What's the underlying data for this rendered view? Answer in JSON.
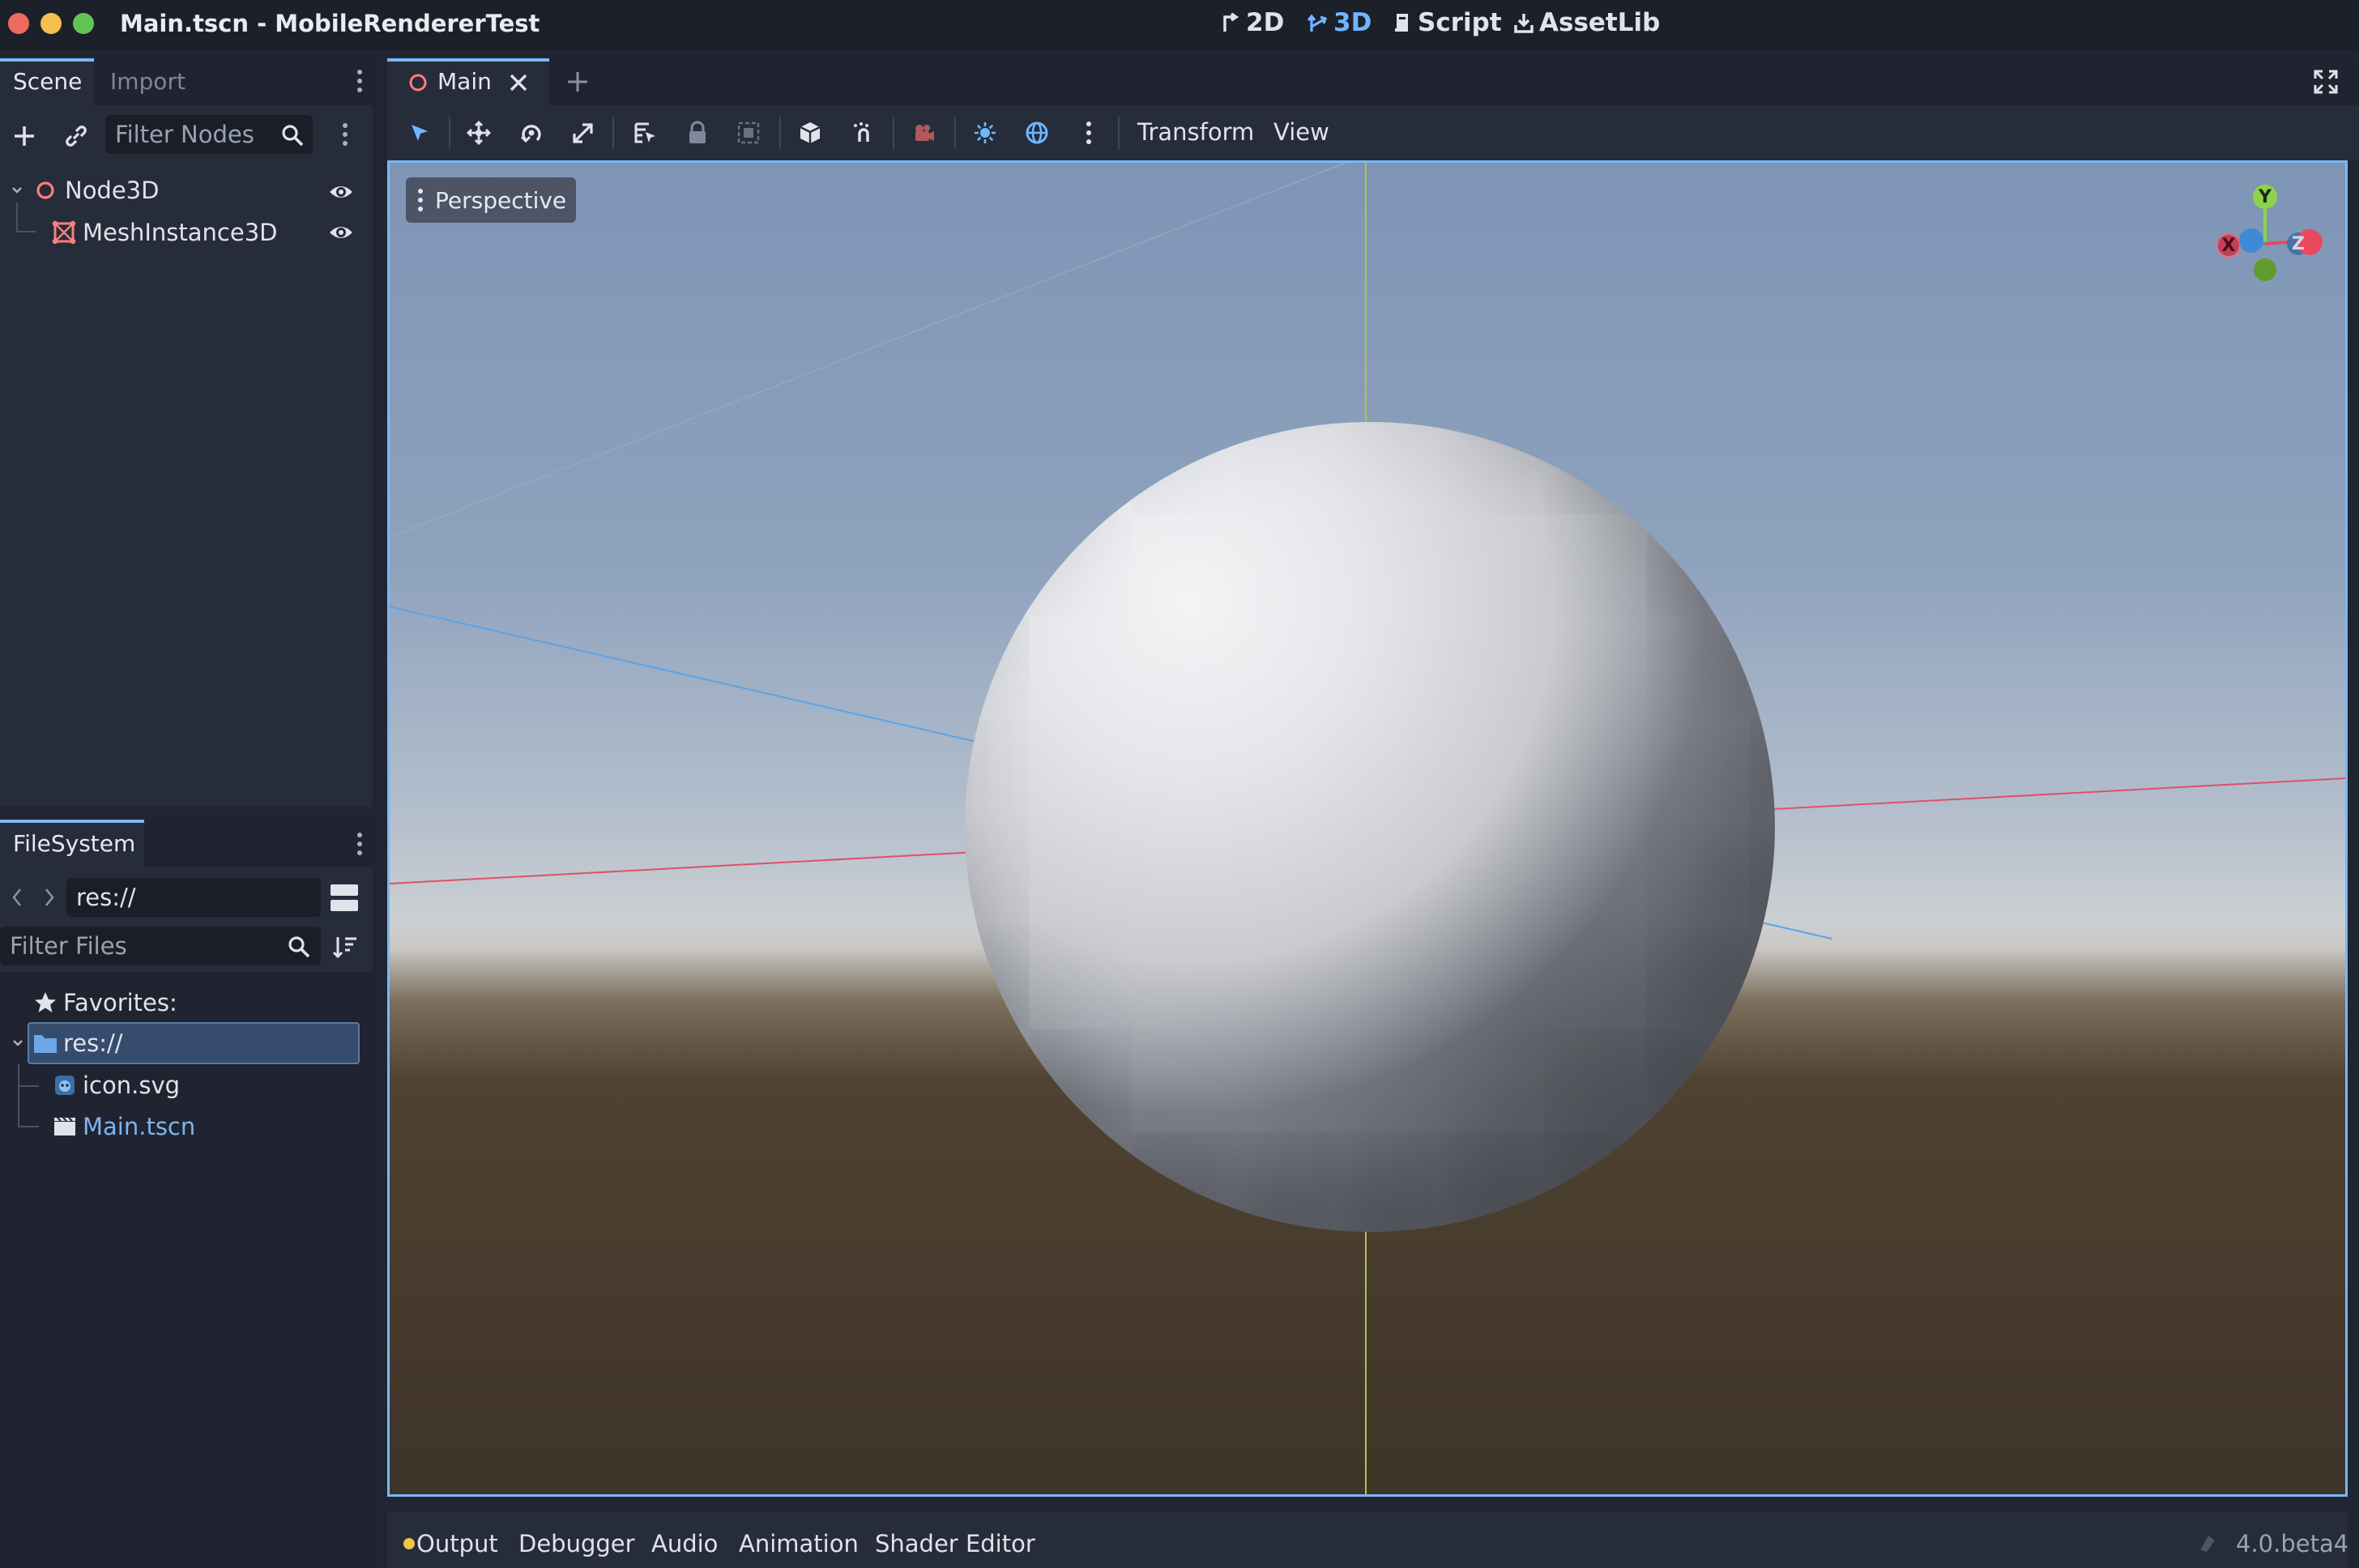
{
  "window": {
    "title": "Main.tscn - MobileRendererTest"
  },
  "workspaces": [
    {
      "label": "2D",
      "icon": "2d-icon",
      "active": false
    },
    {
      "label": "3D",
      "icon": "3d-icon",
      "active": true
    },
    {
      "label": "Script",
      "icon": "script-icon",
      "active": false
    },
    {
      "label": "AssetLib",
      "icon": "assetlib-icon",
      "active": false
    }
  ],
  "scene_dock": {
    "tabs": [
      "Scene",
      "Import"
    ],
    "filter_placeholder": "Filter Nodes",
    "nodes": [
      {
        "name": "Node3D",
        "icon": "node3d-icon",
        "visible_icon": "eye-icon"
      },
      {
        "name": "MeshInstance3D",
        "icon": "meshinstance-icon",
        "visible_icon": "eye-icon"
      }
    ]
  },
  "filesystem_dock": {
    "tab": "FileSystem",
    "path": "res://",
    "filter_placeholder": "Filter Files",
    "favorites_label": "Favorites:",
    "root": "res://",
    "files": [
      {
        "name": "icon.svg",
        "icon": "image-file-icon"
      },
      {
        "name": "Main.tscn",
        "icon": "scene-file-icon"
      }
    ]
  },
  "editor": {
    "scene_tab": "Main",
    "toolbar_menus": [
      "Transform",
      "View"
    ],
    "viewport_label": "Perspective",
    "gizmo": {
      "y": "Y",
      "x": "X",
      "z": "Z"
    }
  },
  "bottom_panel": {
    "tabs": [
      "Output",
      "Debugger",
      "Audio",
      "Animation",
      "Shader Editor"
    ],
    "version": "4.0.beta4"
  },
  "colors": {
    "accent": "#7ab8f5",
    "node_red": "#fc7f7f",
    "axis_x": "#e8495e",
    "axis_y": "#8cd34b",
    "axis_z": "#3d8bd6",
    "output_dot": "#f4c542"
  }
}
